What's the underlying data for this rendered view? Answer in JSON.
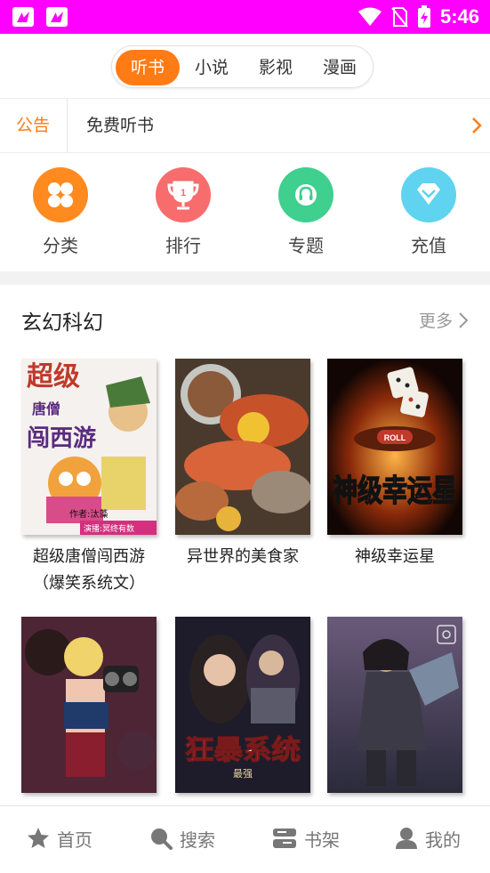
{
  "status_bar": {
    "time": "5:46"
  },
  "tabs": [
    {
      "label": "听书",
      "active": true
    },
    {
      "label": "小说",
      "active": false
    },
    {
      "label": "影视",
      "active": false
    },
    {
      "label": "漫画",
      "active": false
    }
  ],
  "notice": {
    "label": "公告",
    "text": "免费听书"
  },
  "quick_entries": [
    {
      "label": "分类",
      "icon": "grid-icon",
      "color": "#ff8a1f"
    },
    {
      "label": "排行",
      "icon": "trophy-icon",
      "color": "#f76c6c"
    },
    {
      "label": "专题",
      "icon": "headphones-icon",
      "color": "#3fcf8e"
    },
    {
      "label": "充值",
      "icon": "diamond-icon",
      "color": "#5fd3f0"
    }
  ],
  "section": {
    "title": "玄幻科幻",
    "more_label": "更多",
    "books": [
      {
        "title": "超级唐僧闯西游\n（爆笑系统文）"
      },
      {
        "title": "异世界的美食家"
      },
      {
        "title": "神级幸运星"
      },
      {
        "title": ""
      },
      {
        "title": ""
      },
      {
        "title": ""
      }
    ]
  },
  "covers": {
    "c1": {
      "line1": "超级",
      "line2": "唐僧",
      "line3": "闯西游",
      "author": "作者:汰藻",
      "narrator": "演播:冥终有数"
    },
    "c3": {
      "roll": "ROLL",
      "big": "神级幸运星"
    },
    "c5": {
      "big": "狂暴系统",
      "sub": "最强"
    }
  },
  "bottom_nav": [
    {
      "label": "首页",
      "icon": "star-icon"
    },
    {
      "label": "搜索",
      "icon": "search-icon"
    },
    {
      "label": "书架",
      "icon": "bookshelf-icon"
    },
    {
      "label": "我的",
      "icon": "user-icon"
    }
  ],
  "colors": {
    "accent": "#ff7b16",
    "status_bar": "#ff00ff"
  }
}
